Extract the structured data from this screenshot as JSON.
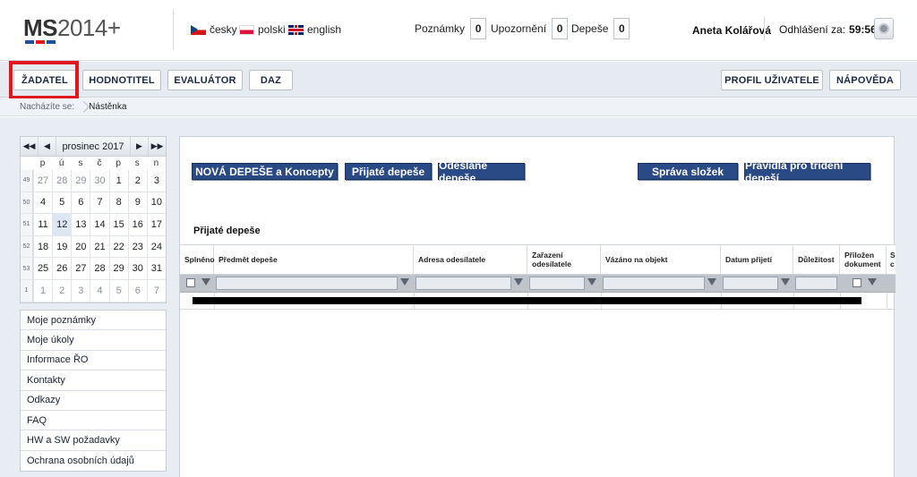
{
  "header": {
    "logo": {
      "bold": "MS",
      "light": "2014+"
    },
    "logo_colors": [
      "#1f4e9a",
      "#e0171f",
      "#1f4e9a"
    ],
    "languages": [
      {
        "label": "česky",
        "icon": "flag-cz-icon"
      },
      {
        "label": "polski",
        "icon": "flag-pl-icon"
      },
      {
        "label": "english",
        "icon": "flag-en-icon"
      }
    ],
    "counters": [
      {
        "label": "Poznámky",
        "value": "0"
      },
      {
        "label": "Upozornění",
        "value": "0"
      },
      {
        "label": "Depeše",
        "value": "0"
      }
    ],
    "user_name": "Aneta Kolářová",
    "logout_label": "Odhlášení za:",
    "logout_time": "59:56"
  },
  "nav": {
    "items": [
      "ŽADATEL",
      "HODNOTITEL",
      "EVALUÁTOR",
      "DAZ"
    ],
    "right_items": [
      "PROFIL UŽIVATELE",
      "NÁPOVĚDA"
    ],
    "highlight_color": "#e0171f"
  },
  "breadcrumb": {
    "label": "Nacházíte se:",
    "current": "Nástěnka"
  },
  "calendar": {
    "month_label": "prosinec 2017",
    "weekdays": [
      "p",
      "ú",
      "s",
      "č",
      "p",
      "s",
      "n"
    ],
    "weeks": [
      {
        "num": "49",
        "days": [
          "27",
          "28",
          "29",
          "30",
          "1",
          "2",
          "3"
        ]
      },
      {
        "num": "50",
        "days": [
          "4",
          "5",
          "6",
          "7",
          "8",
          "9",
          "10"
        ]
      },
      {
        "num": "51",
        "days": [
          "11",
          "12",
          "13",
          "14",
          "15",
          "16",
          "17"
        ]
      },
      {
        "num": "52",
        "days": [
          "18",
          "19",
          "20",
          "21",
          "22",
          "23",
          "24"
        ]
      },
      {
        "num": "53",
        "days": [
          "25",
          "26",
          "27",
          "28",
          "29",
          "30",
          "31"
        ]
      },
      {
        "num": "1",
        "days": [
          "1",
          "2",
          "3",
          "4",
          "5",
          "6",
          "7"
        ]
      }
    ],
    "today": "12"
  },
  "left_menu": [
    "Moje poznámky",
    "Moje úkoly",
    "Informace ŘO",
    "Kontakty",
    "Odkazy",
    "FAQ",
    "HW a SW požadavky",
    "Ochrana osobních údajů"
  ],
  "actions": {
    "new": "NOVÁ DEPEŠE a Koncepty",
    "received": "Přijaté depeše",
    "sent": "Odeslané depeše",
    "folders": "Správa složek",
    "rules": "Pravidla pro třídění depeší"
  },
  "table": {
    "title": "Přijaté depeše",
    "columns": [
      "Splněno",
      "Předmět depeše",
      "Adresa odesílatele",
      "Zařazení odesílatele",
      "Vázáno na objekt",
      "Datum přijetí",
      "Důležitost",
      "Přiložen dokument",
      "S c"
    ]
  }
}
